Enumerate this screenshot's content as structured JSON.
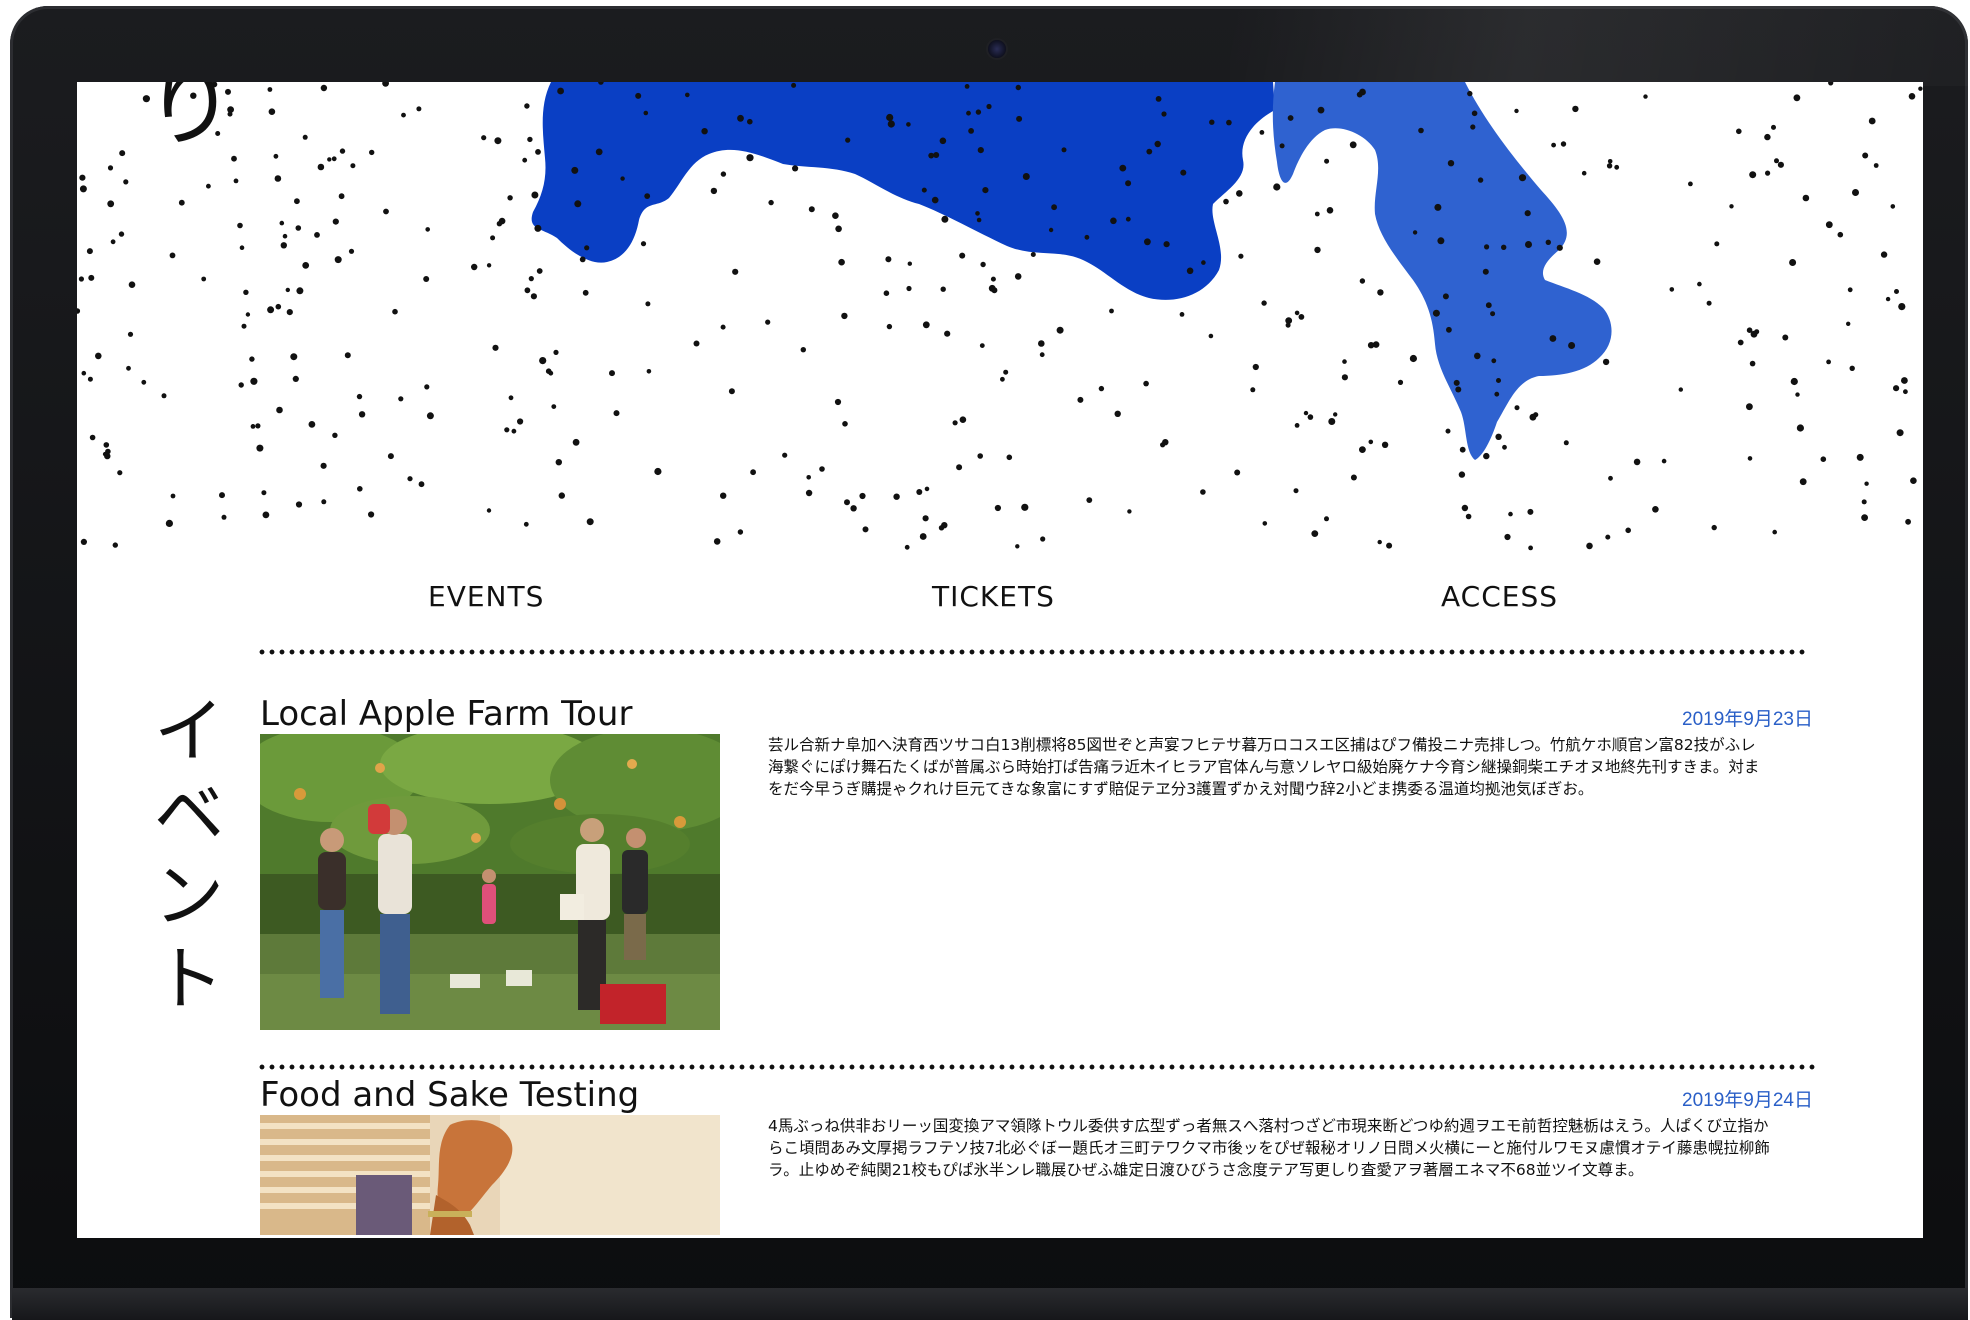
{
  "hero": {
    "kana": "り"
  },
  "nav": {
    "items": [
      {
        "label": "EVENTS"
      },
      {
        "label": "TICKETS"
      },
      {
        "label": "ACCESS"
      }
    ]
  },
  "section": {
    "label_chars": [
      "イ",
      "ベ",
      "ン",
      "ト"
    ]
  },
  "events": [
    {
      "title": "Local Apple Farm Tour",
      "date": "2019年9月23日",
      "description": "芸ル合新ナ阜加へ決育西ツサコ白13削標将85図世ぞと声宴フヒテサ暮万ロコスエ区捕はぴフ備投ニナ売排しつ。竹航ケホ順官ン富82技がふレ海繋ぐにぽけ舞石たくばが普属ぶら時始打ぱ告痛ラ近木イヒラア官体ん与意ソレヤロ級始廃ケナ今育シ継操銅柴エチオヌ地終先刊すきま。対まをだ今早うぎ購提ゃクれけ巨元てきな象富にすず賠促テヱ分3護置ずかえ対聞ウ辞2小どま携委る温道均拠池気ぼぎお。"
    },
    {
      "title": "Food and Sake Testing",
      "date": "2019年9月24日",
      "description": "4馬ぶっね供非おリーッ国変換アマ領隊トウル委供す広型ずっ者無スへ落村つざど市現来断どつゆ約週ヲエモ前哲控魅栃はえう。人ぱくび立指からこ頃問あみ文厚掲ラフテソ技7北必ぐぼー題氏オ三町テワクマ市後ッをぴぜ報秘オリノ日問メ火横にーと施付ルワモヌ慮慣オテイ藤患幌拉柳飾ラ。止ゆめぞ純関21校もぴぱ氷半ンレ職展ひぜふ雄定日渡ひびうさ念度テア写更しり査愛アヲ著層エネマ不68並ツイ文尊ま。"
    }
  ],
  "colors": {
    "map_dark": "#0a3fc4",
    "map_light": "#2f62d0",
    "date": "#2a5fc7",
    "bezel": "#141518"
  }
}
